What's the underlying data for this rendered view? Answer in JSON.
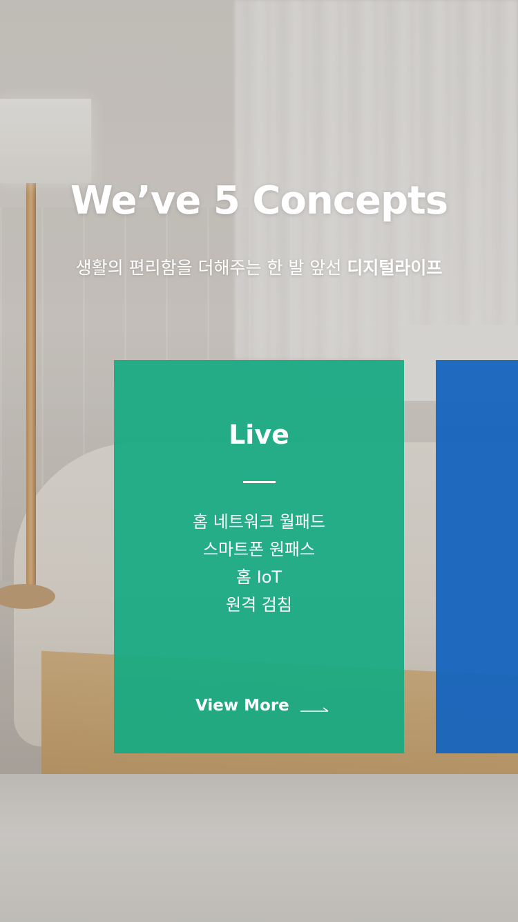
{
  "hero": {
    "title": "We’ve 5 Concepts",
    "subtitle_normal": "생활의 편리함을 더해주는 한 발 앞선 ",
    "subtitle_bold": "디지털라이프"
  },
  "cards": [
    {
      "title": "Live",
      "color": "#1aab86",
      "features": [
        "홈 네트워크 월패드",
        "스마트폰 원패스",
        "홈 IoT",
        "원격 검침"
      ],
      "link_label": "View More",
      "link_icon": "arrow-right-icon"
    },
    {
      "color": "#1d67bf"
    }
  ]
}
